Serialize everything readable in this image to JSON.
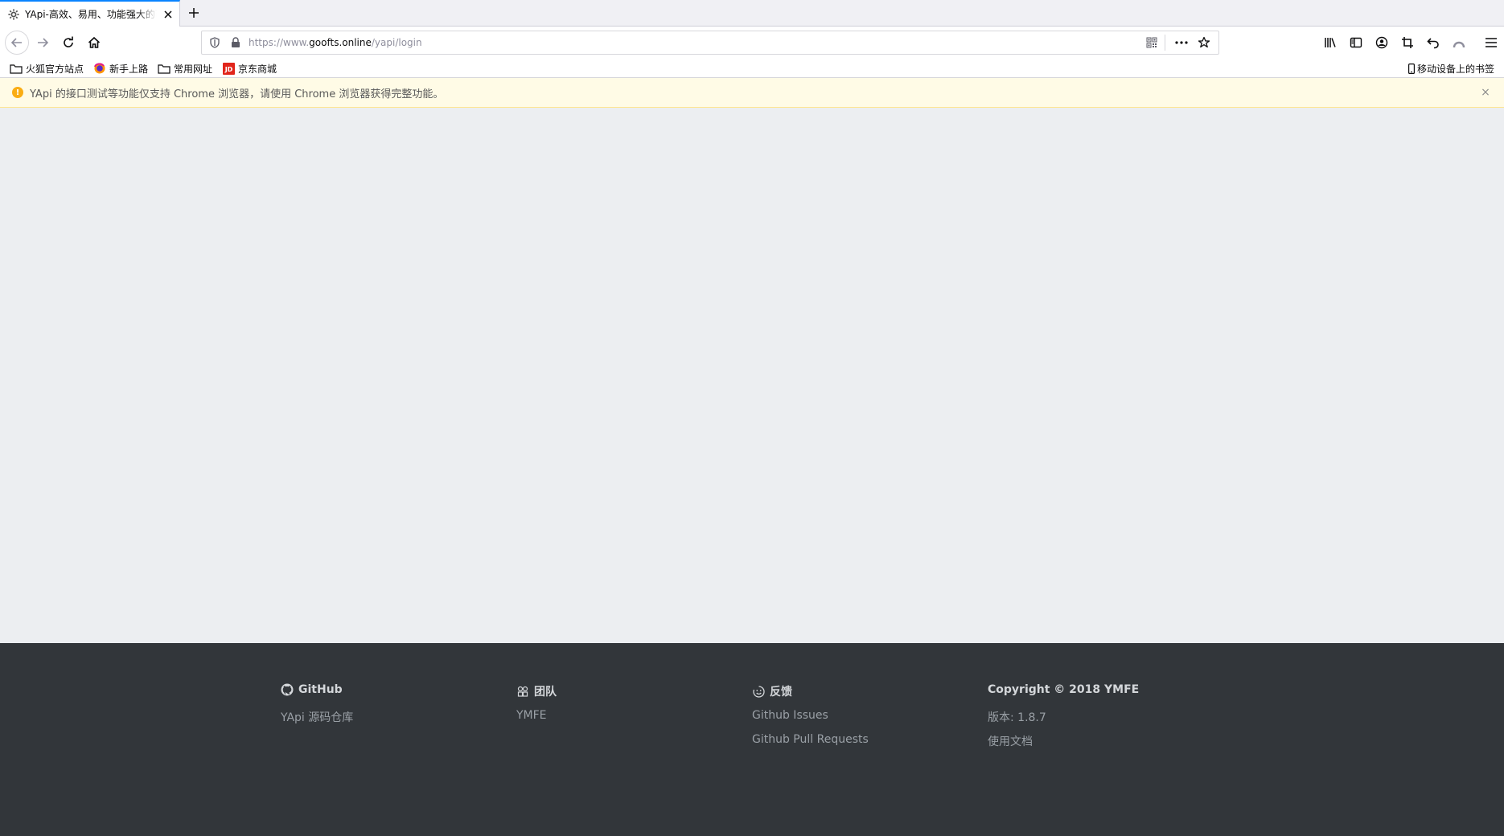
{
  "tab": {
    "title": "YApi-高效、易用、功能强大的可视化接口管理平台",
    "favicon": "yapi-gear-icon"
  },
  "urlbar": {
    "prefix": "https://www.",
    "host": "goofts.online",
    "path": "/yapi/login"
  },
  "bookmarks": [
    {
      "label": "火狐官方站点",
      "icon": "folder-icon"
    },
    {
      "label": "新手上路",
      "icon": "firefox-icon"
    },
    {
      "label": "常用网址",
      "icon": "folder-icon"
    },
    {
      "label": "京东商城",
      "icon": "jd-icon"
    }
  ],
  "mobile_bookmarks": "移动设备上的书签",
  "alert": {
    "text": "YApi 的接口测试等功能仅支持 Chrome 浏览器，请使用 Chrome 浏览器获得完整功能。",
    "icon_glyph": "!",
    "close_glyph": "×"
  },
  "footer": {
    "github": {
      "title": "GitHub",
      "links": [
        "YApi 源码仓库"
      ]
    },
    "team": {
      "title": "团队",
      "links": [
        "YMFE"
      ]
    },
    "feedback": {
      "title": "反馈",
      "links": [
        "Github Issues",
        "Github Pull Requests"
      ]
    },
    "copyright": {
      "title": "Copyright © 2018 YMFE",
      "links": [
        "版本: 1.8.7",
        "使用文档"
      ]
    }
  },
  "colors": {
    "tab_accent": "#0a84ff",
    "page_bg": "#eceef1",
    "alert_bg": "#fffbe6",
    "alert_icon": "#faad14",
    "footer_bg": "#32363a"
  }
}
